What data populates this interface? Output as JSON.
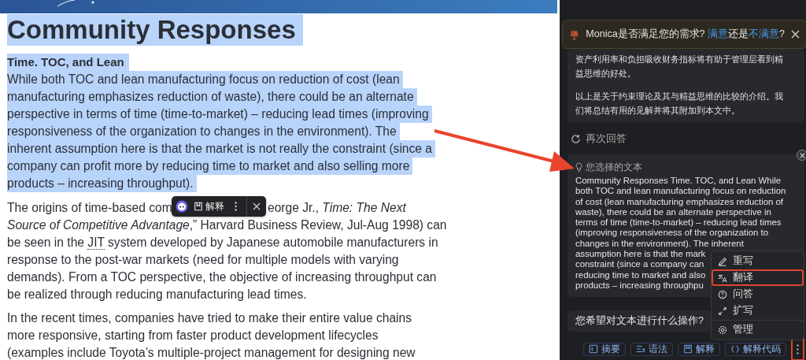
{
  "article": {
    "heading": "Community Responses",
    "subheading": "Time. TOC, and Lean",
    "selected_lines": [
      "While both TOC and lean manufacturing focus on reduction of cost (lean",
      "manufacturing emphasizes reduction of waste), there could be an alternate",
      "perspective in terms of time (time-to-market) – reducing lead times (improving",
      "responsiveness of the organization to changes in the environment). The",
      "inherent assumption here is that the market is not really the constraint (since a",
      "company can profit more by reducing time to market and also selling more",
      "products – increasing throughput)."
    ],
    "paragraph_2": {
      "start": "The origins of time-based com",
      "first_line_rest": "eorge Jr., *Time: The Next*",
      "line_2": "*Source of Competitive Advantage*,” Harvard Business Review, Jul-Aug 1998) can",
      "before_link": "be seen in the",
      "link": "JIT",
      "after_link": "system developed by Japanese automobile manufacturers in",
      "more_lines": [
        "response to the post-war markets (need for multiple models with varying",
        "demands). From a TOC perspective, the objective of increasing throughput can",
        "be realized through reducing manufacturing lead times."
      ]
    },
    "paragraph_3_lines": [
      "In the recent times, companies have tried to make their entire value chains",
      "more responsive, starting from faster product development lifecycles",
      "(examples include Toyota’s multiple-project management for designing new"
    ]
  },
  "selection_toolbar": {
    "explain_label": "解释"
  },
  "assistant": {
    "feedback": {
      "question": "Monica是否满足您的需求?",
      "satisfied": "满意",
      "middle": "还是",
      "unsatisfied": "不满意",
      "end": "?"
    },
    "reply": [
      "资产利用率和负担吸收财务指标将有助于管理层看到精益思维的好处。",
      "以上是关于约束理论及其与精益思维的比较的介绍。我们将总结有用的见解并将其附加到本文中。"
    ],
    "regenerate": "再次回答",
    "selected_text": {
      "label": "您选择的文本",
      "lines": [
        "Community Responses Time. TOC, and Lean While",
        "both TOC and lean manufacturing focus on reduction",
        "of cost (lean manufacturing emphasizes reduction of",
        "waste), there could be an alternate perspective in",
        "terms of time (time-to-market) – reducing lead times",
        "(improving responsiveness of the organization to",
        "changes in the environment). The inherent",
        "assumption here is that the mark",
        "constraint (since a company can",
        "reducing time to market and also",
        "products – increasing throughpu"
      ]
    },
    "prompt": "您希望对文本进行什么操作?",
    "actions": [
      {
        "label": "摘要",
        "kind": "summary"
      },
      {
        "label": "语法",
        "kind": "grammar"
      },
      {
        "label": "解释",
        "kind": "explain"
      },
      {
        "label": "解释代码",
        "kind": "code"
      }
    ],
    "more_button": {
      "highlighted": true
    },
    "menu": [
      {
        "label": "重写",
        "kind": "rewrite",
        "highlighted": false
      },
      {
        "label": "翻译",
        "kind": "translate",
        "highlighted": true
      },
      {
        "label": "问答",
        "kind": "qa",
        "highlighted": false
      },
      {
        "label": "扩写",
        "kind": "expand",
        "highlighted": false
      },
      {
        "label": "管理",
        "kind": "manage",
        "highlighted": false
      }
    ]
  }
}
